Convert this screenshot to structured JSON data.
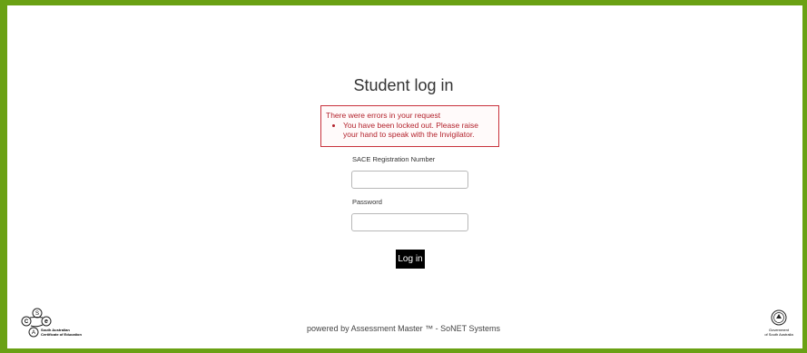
{
  "login": {
    "title": "Student log in",
    "error_heading": "There were errors in your request",
    "errors": [
      "You have been locked out. Please raise your hand to speak with the Invigilator."
    ],
    "registration_label": "SACE Registration Number",
    "registration_value": "",
    "password_label": "Password",
    "password_value": "",
    "submit_label": "Log in"
  },
  "footer": {
    "powered_by": "powered by Assessment Master ™ - SoNET Systems",
    "sace_logo_letters": [
      "S",
      "C",
      "e",
      "A"
    ],
    "sace_logo_text_1": "South Australian",
    "sace_logo_text_2": "Certificate of Education",
    "gov_logo_text_1": "Government",
    "gov_logo_text_2": "of South Australia"
  },
  "colors": {
    "frame": "#6aa114",
    "error": "#c8323c",
    "button": "#000000"
  }
}
